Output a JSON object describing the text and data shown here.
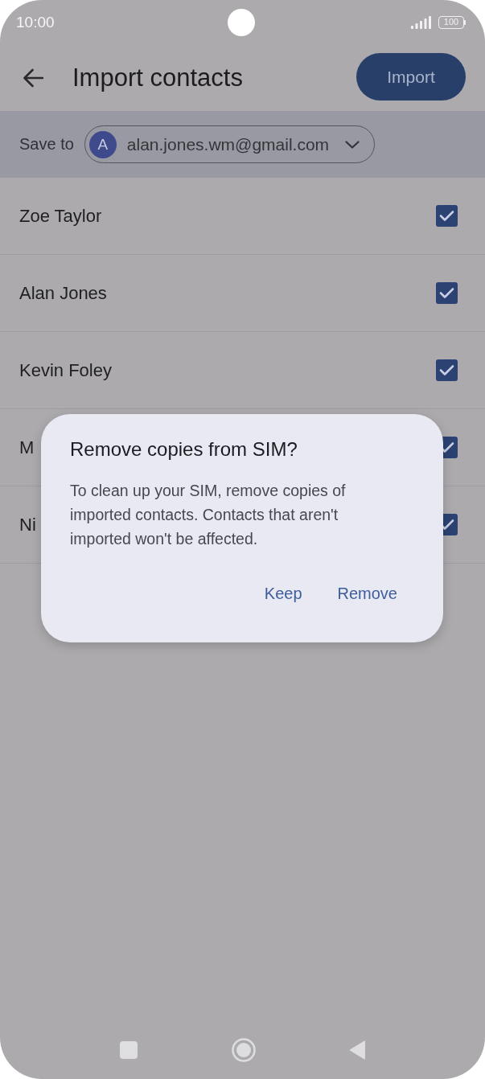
{
  "status_bar": {
    "time": "10:00",
    "battery": "100"
  },
  "app_bar": {
    "title": "Import contacts",
    "action": "Import"
  },
  "save_to": {
    "label": "Save to",
    "account": {
      "initial": "A",
      "email": "alan.jones.wm@gmail.com"
    }
  },
  "contacts": [
    {
      "name": "Zoe Taylor",
      "checked": true
    },
    {
      "name": "Alan Jones",
      "checked": true
    },
    {
      "name": "Kevin Foley",
      "checked": true
    },
    {
      "name": "M",
      "checked": true
    },
    {
      "name": "Ni",
      "checked": true
    }
  ],
  "dialog": {
    "title": "Remove copies from SIM?",
    "message": "To clean up your SIM, remove copies of imported contacts. Contacts that aren't imported won't be affected.",
    "buttons": [
      "Keep",
      "Remove"
    ]
  }
}
